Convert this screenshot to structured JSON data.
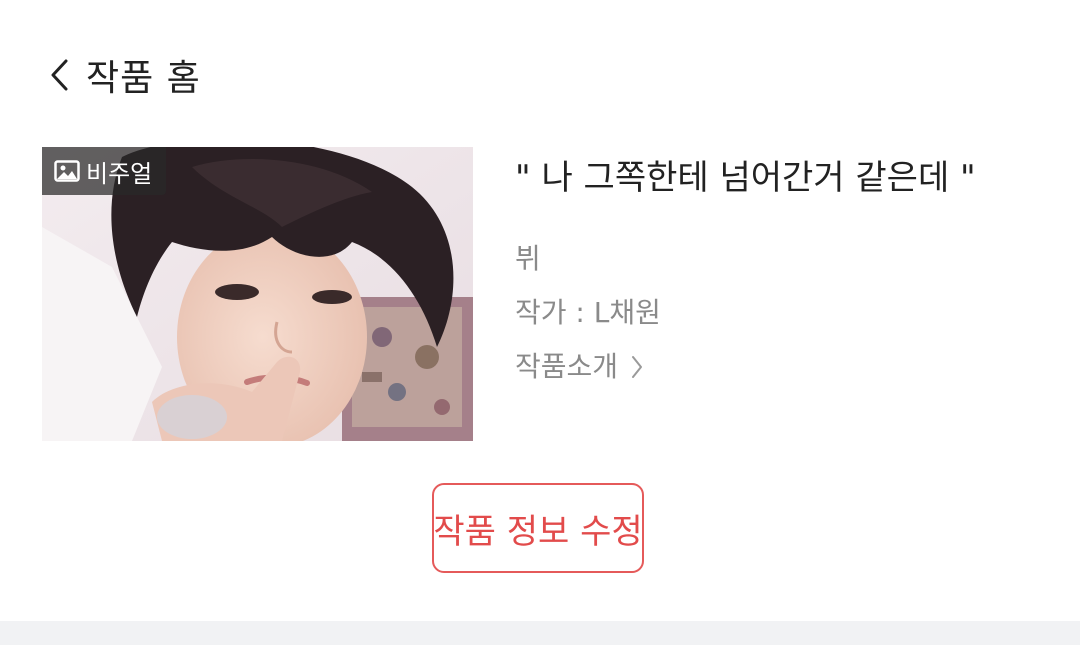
{
  "header": {
    "back_icon": "chevron-left-icon",
    "title": "작품 홈"
  },
  "work": {
    "badge_icon": "image-icon",
    "badge_label": "비주얼",
    "title": "\" 나 그쪽한테 넘어간거 같은데  \"",
    "character": "뷔",
    "author": "작가 : L채원",
    "intro_label": "작품소개",
    "intro_icon": "chevron-right-icon"
  },
  "actions": {
    "edit_label": "작품 정보 수정"
  },
  "colors": {
    "accent": "#e55a5a",
    "text_primary": "#222222",
    "text_secondary": "#8a8a8a",
    "divider": "#f1f2f4"
  }
}
